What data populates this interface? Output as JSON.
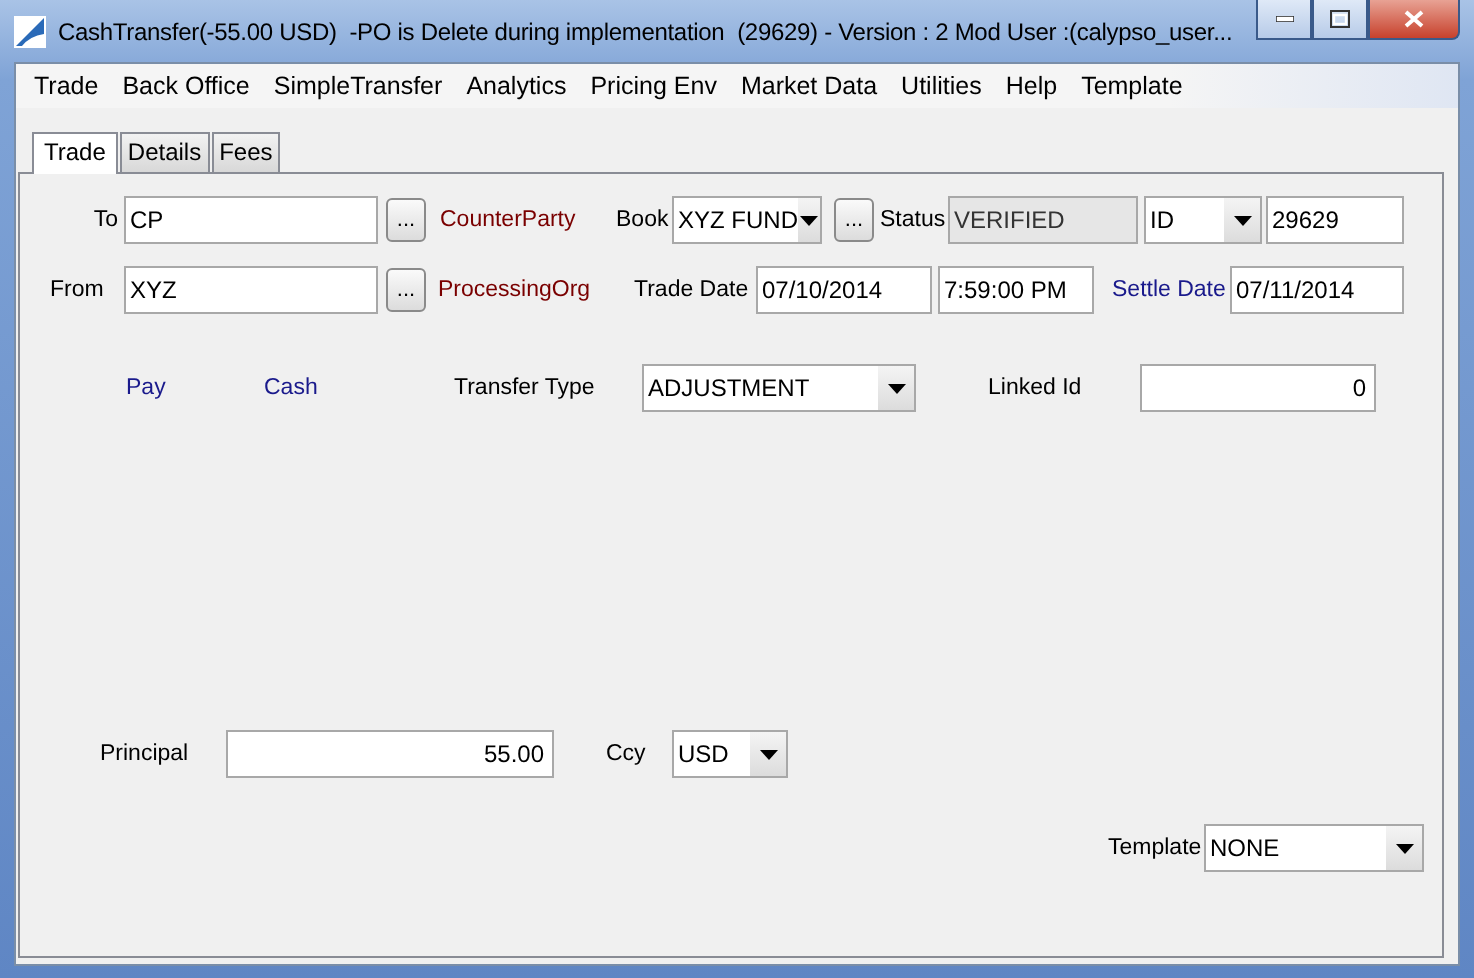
{
  "window": {
    "title": "CashTransfer(-55.00 USD)  -PO is Delete during implementation  (29629) - Version : 2 Mod User :(calypso_user..."
  },
  "menu": [
    "Trade",
    "Back Office",
    "SimpleTransfer",
    "Analytics",
    "Pricing Env",
    "Market Data",
    "Utilities",
    "Help",
    "Template"
  ],
  "tabs": [
    {
      "label": "Trade",
      "selected": true
    },
    {
      "label": "Details",
      "selected": false
    },
    {
      "label": "Fees",
      "selected": false
    }
  ],
  "form": {
    "rows": [
      {
        "items": [
          {
            "kind": "label",
            "text": "To"
          },
          {
            "kind": "field",
            "value": "CP",
            "disabled": false
          },
          {
            "kind": "lookup",
            "text": "..."
          },
          {
            "kind": "name",
            "text": "CounterParty"
          },
          {
            "kind": "label",
            "text": "Book"
          },
          {
            "kind": "dropdown",
            "value": "XYZ FUND"
          },
          {
            "kind": "lookup",
            "text": "..."
          },
          {
            "kind": "label",
            "text": "Status"
          },
          {
            "kind": "field",
            "value": "VERIFIED",
            "disabled": true
          },
          {
            "kind": "dropdown",
            "value": "ID"
          },
          {
            "kind": "field",
            "value": "29629",
            "disabled": false
          }
        ]
      },
      {
        "items": [
          {
            "kind": "label",
            "text": "From"
          },
          {
            "kind": "field",
            "value": "XYZ",
            "disabled": false
          },
          {
            "kind": "lookup",
            "text": "..."
          },
          {
            "kind": "name",
            "text": "ProcessingOrg"
          },
          {
            "kind": "label",
            "text": "Trade Date"
          },
          {
            "kind": "field",
            "value": "07/10/2014",
            "disabled": false
          },
          {
            "kind": "field",
            "value": "7:59:00 PM",
            "disabled": false
          },
          {
            "kind": "link",
            "text": "Settle Date"
          },
          {
            "kind": "field",
            "value": "07/11/2014",
            "disabled": false
          }
        ]
      },
      {
        "items": [
          {
            "kind": "link",
            "text": "Pay"
          },
          {
            "kind": "link",
            "text": "Cash"
          },
          {
            "kind": "label",
            "text": "Transfer Type"
          },
          {
            "kind": "dropdown",
            "value": "ADJUSTMENT"
          },
          {
            "kind": "label",
            "text": "Linked Id"
          },
          {
            "kind": "number",
            "value": "0"
          }
        ]
      },
      {
        "items": [
          {
            "kind": "label",
            "text": "Principal"
          },
          {
            "kind": "number",
            "value": "55.00"
          },
          {
            "kind": "label",
            "text": "Ccy"
          },
          {
            "kind": "dropdown",
            "value": "USD"
          }
        ]
      },
      {
        "items": [
          {
            "kind": "label",
            "text": "Template"
          },
          {
            "kind": "dropdown",
            "value": "NONE"
          }
        ]
      }
    ]
  }
}
